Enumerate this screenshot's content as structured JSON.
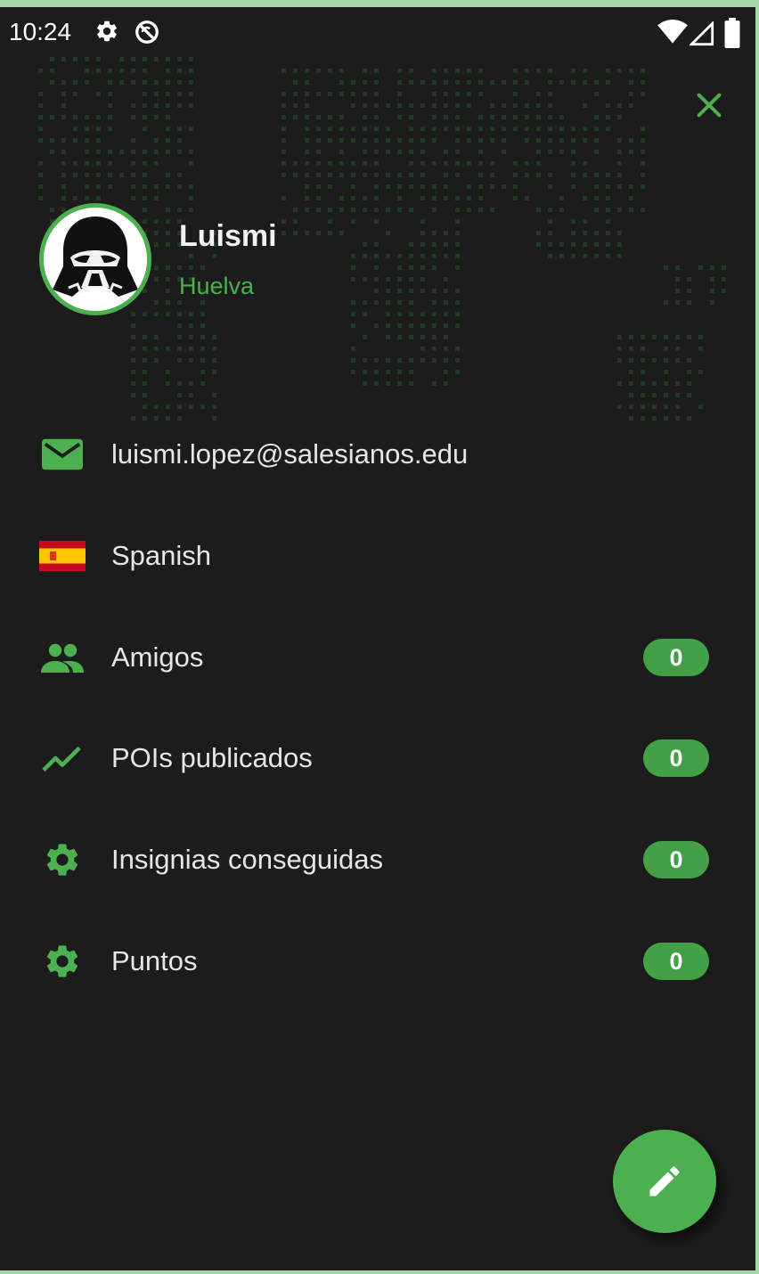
{
  "status_bar": {
    "time": "10:24",
    "left_icons": [
      "gear-icon",
      "no-sync-icon"
    ],
    "right_icons": [
      "wifi-icon",
      "signal-icon",
      "battery-icon"
    ]
  },
  "drawer": {
    "close_icon": "close-icon",
    "profile": {
      "name": "Luismi",
      "city": "Huelva",
      "avatar_icon": "darth-vader-avatar-icon"
    },
    "items": [
      {
        "icon": "mail-icon",
        "label": "luismi.lopez@salesianos.edu"
      },
      {
        "icon": "spain-flag-icon",
        "label": "Spanish"
      },
      {
        "icon": "people-icon",
        "label": "Amigos",
        "badge": "0"
      },
      {
        "icon": "trending-up-icon",
        "label": "POIs publicados",
        "badge": "0"
      },
      {
        "icon": "gear-icon",
        "label": "Insignias conseguidas",
        "badge": "0"
      },
      {
        "icon": "gear-icon",
        "label": "Puntos",
        "badge": "0"
      }
    ],
    "fab_icon": "edit-pencil-icon"
  },
  "colors": {
    "accent": "#4caf50",
    "background": "#1c1c1c",
    "text": "#e6e6e6",
    "badge": "#43a047"
  }
}
